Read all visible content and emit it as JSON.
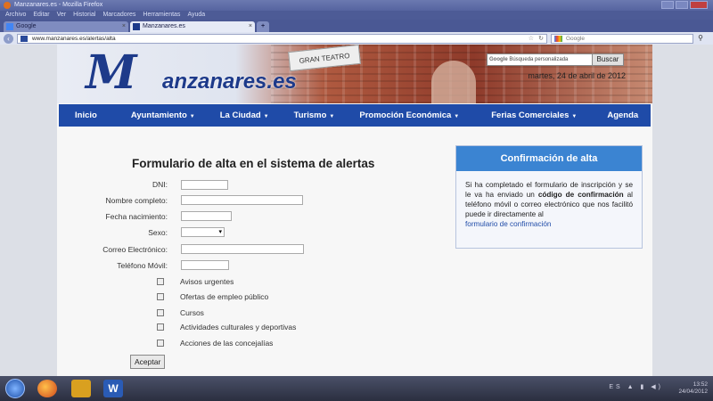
{
  "window": {
    "title": "Manzanares.es - Mozilla Firefox"
  },
  "menubar": [
    "Archivo",
    "Editar",
    "Ver",
    "Historial",
    "Marcadores",
    "Herramientas",
    "Ayuda"
  ],
  "tabs": [
    {
      "label": "Google"
    },
    {
      "label": "Manzanares.es"
    }
  ],
  "navbar": {
    "url": "www.manzanares.es/alertas/alta",
    "search_placeholder": "Google"
  },
  "header": {
    "logo_initial": "M",
    "logo_text": "anzanares.es",
    "search_brand": "Google",
    "search_placeholder": "Búsqueda personalizada",
    "search_button": "Buscar",
    "date": "martes, 24 de abril de 2012",
    "sign_text": "GRAN TEATRO"
  },
  "main_nav": [
    {
      "label": "Inicio",
      "dropdown": false
    },
    {
      "label": "Ayuntamiento",
      "dropdown": true
    },
    {
      "label": "La Ciudad",
      "dropdown": true
    },
    {
      "label": "Turismo",
      "dropdown": true
    },
    {
      "label": "Promoción Económica",
      "dropdown": true
    },
    {
      "label": "Ferias Comerciales",
      "dropdown": true
    },
    {
      "label": "Agenda",
      "dropdown": false
    }
  ],
  "form": {
    "title": "Formulario de alta en el sistema de alertas",
    "fields": [
      {
        "label": "DNI:",
        "value": ""
      },
      {
        "label": "Nombre completo:",
        "value": ""
      },
      {
        "label": "Fecha nacimiento:",
        "value": ""
      },
      {
        "label": "Sexo:",
        "value": ""
      },
      {
        "label": "Correo Electrónico:",
        "value": ""
      },
      {
        "label": "Teléfono Móvil:",
        "value": ""
      }
    ],
    "checkboxes": [
      {
        "label": "Avisos urgentes",
        "checked": false
      },
      {
        "label": "Ofertas de empleo público",
        "checked": false
      },
      {
        "label": "Cursos",
        "checked": false
      },
      {
        "label": "Actividades culturales y deportivas",
        "checked": false
      },
      {
        "label": "Acciones de las concejalías",
        "checked": false
      }
    ],
    "submit_label": "Aceptar"
  },
  "confirm": {
    "title": "Confirmación de alta",
    "text_before": "Si ha completado el formulario de inscripción y se le va ha enviado un ",
    "bold": "código de confirmación",
    "text_after": " al teléfono móvil o correo electrónico que nos facilitó puede ir directamente al",
    "link": "formulario de confirmación"
  },
  "taskbar": {
    "word_label": "W",
    "lang": "ES",
    "time": "13:52",
    "date": "24/04/2012"
  },
  "colors": {
    "nav_blue": "#1f4ba8",
    "confirm_head": "#3b84d2",
    "logo_blue": "#1d3a8a"
  }
}
